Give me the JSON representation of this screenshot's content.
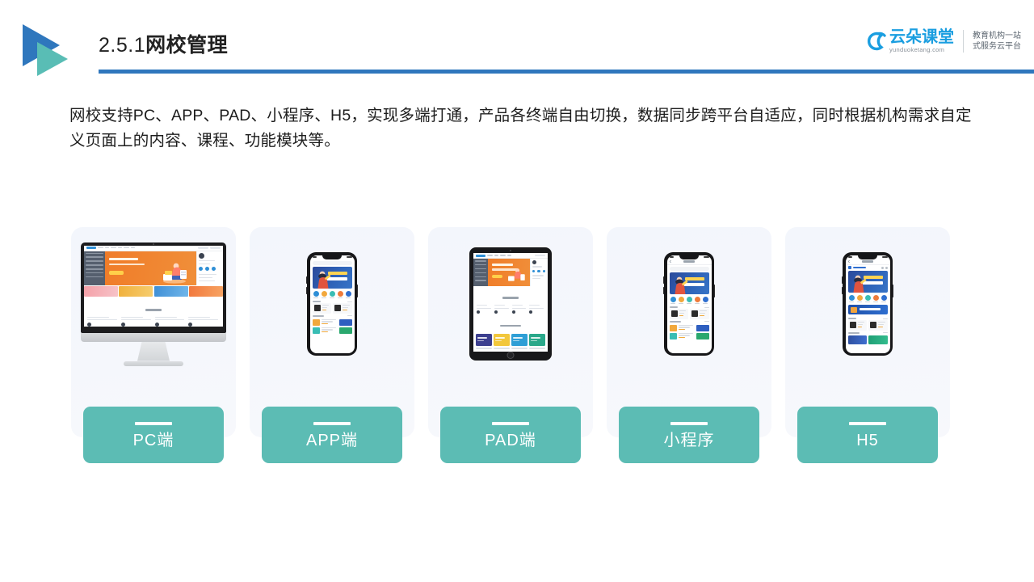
{
  "header": {
    "title_number": "2.5.1",
    "title_name": "网校管理",
    "accent_blue": "#2f77bd",
    "accent_teal": "#59bdb5"
  },
  "brand": {
    "name_cn": "云朵课堂",
    "name_en": "yunduoketang.com",
    "tagline_line1": "教育机构一站",
    "tagline_line2": "式服务云平台",
    "color": "#1a9ee0"
  },
  "body": {
    "paragraph": "网校支持PC、APP、PAD、小程序、H5，实现多端打通，产品各终端自由切换，数据同步跨平台自适应，同时根据机构需求自定义页面上的内容、课程、功能模块等。"
  },
  "cards": [
    {
      "label": "PC端",
      "device": "desktop-monitor"
    },
    {
      "label": "APP端",
      "device": "smartphone"
    },
    {
      "label": "PAD端",
      "device": "tablet"
    },
    {
      "label": "小程序",
      "device": "smartphone"
    },
    {
      "label": "H5",
      "device": "smartphone"
    }
  ],
  "theme": {
    "label_button_color": "#5cbcb4",
    "card_background": "#f4f6fc",
    "page_background": "#ffffff",
    "text_color": "#1d1d1d"
  }
}
